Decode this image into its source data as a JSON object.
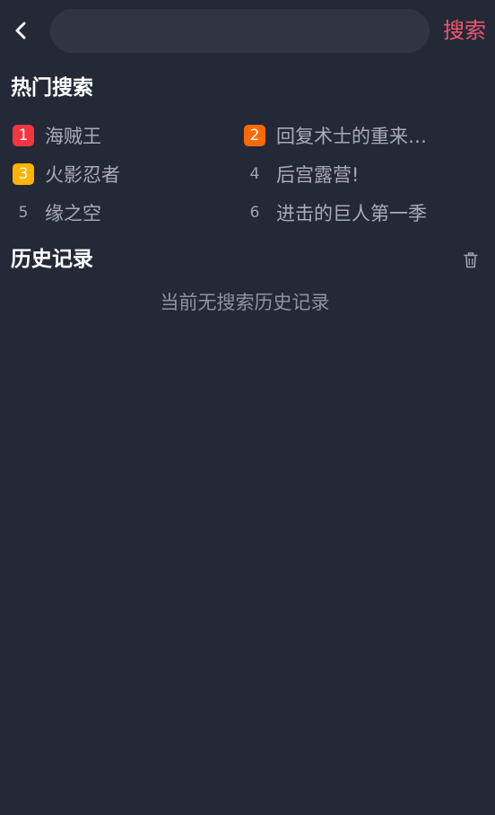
{
  "header": {
    "search_placeholder": "",
    "search_value": "",
    "search_button_label": "搜索"
  },
  "hot_search": {
    "title": "热门搜索",
    "items": [
      {
        "rank": "1",
        "label": "海贼王",
        "badge_color": "#f2353f"
      },
      {
        "rank": "2",
        "label": "回复术士的重来…",
        "badge_color": "#ff6a00"
      },
      {
        "rank": "3",
        "label": "火影忍者",
        "badge_color": "#ffb400"
      },
      {
        "rank": "4",
        "label": "后宫露营!",
        "badge_color": ""
      },
      {
        "rank": "5",
        "label": "缘之空",
        "badge_color": ""
      },
      {
        "rank": "6",
        "label": "进击的巨人第一季",
        "badge_color": ""
      }
    ]
  },
  "history": {
    "title": "历史记录",
    "empty_text": "当前无搜索历史记录"
  },
  "colors": {
    "background": "#242938",
    "accent": "#f0556f",
    "input_bg": "#303544"
  },
  "icons": {
    "back": "chevron-left-icon",
    "clear_history": "trash-icon"
  }
}
